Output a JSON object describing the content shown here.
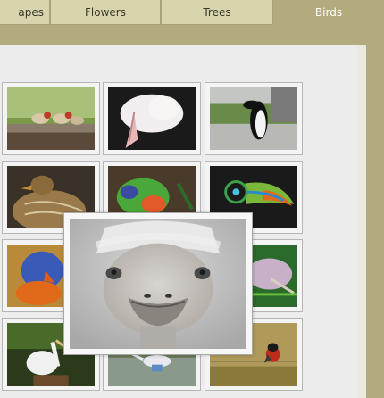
{
  "tabs": [
    {
      "label": "apes",
      "active": false
    },
    {
      "label": "Flowers",
      "active": false
    },
    {
      "label": "Trees",
      "active": false
    },
    {
      "label": "Birds",
      "active": true
    }
  ],
  "gallery": {
    "thumbnails": [
      {
        "subject": "finches on log"
      },
      {
        "subject": "pelican"
      },
      {
        "subject": "penguin"
      },
      {
        "subject": "duck"
      },
      {
        "subject": "lorikeet"
      },
      {
        "subject": "toucan"
      },
      {
        "subject": "blue parrot"
      },
      {
        "subject": "hidden"
      },
      {
        "subject": "heron"
      },
      {
        "subject": "pelican"
      },
      {
        "subject": "heron in water"
      },
      {
        "subject": "small bird on wire"
      }
    ],
    "enlarged": {
      "subject": "ostrich"
    }
  },
  "colors": {
    "frame": "#b3ab7d",
    "tab_inactive": "#d8d5ae",
    "panel": "#ececec",
    "active_tab_text": "#ffffff"
  }
}
